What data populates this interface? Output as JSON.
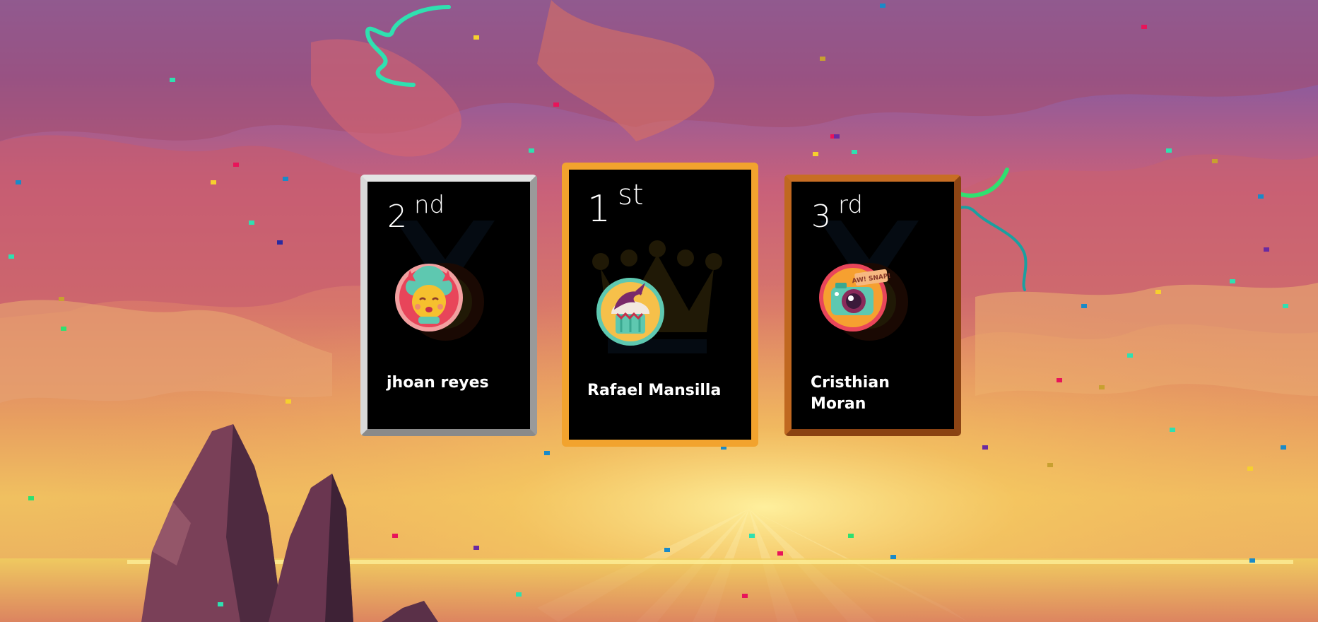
{
  "podium": {
    "second": {
      "place_number": "2",
      "place_suffix": "nd",
      "player_name": "jhoan reyes",
      "avatar": "dragon-avatar-icon",
      "frame_color": "#c8c8c8"
    },
    "first": {
      "place_number": "1",
      "place_suffix": "st",
      "player_name": "Rafael Mansilla",
      "avatar": "cupcake-avatar-icon",
      "frame_color": "#f2a32e"
    },
    "third": {
      "place_number": "3",
      "place_suffix": "rd",
      "player_name": "Cristhian Moran",
      "avatar": "camera-avatar-icon",
      "frame_color": "#b8601e",
      "avatar_sticker_text": "AW! SNAP!"
    }
  },
  "background": {
    "scene": "sunset-canyon-illustration",
    "effects": "confetti-and-streamers"
  }
}
